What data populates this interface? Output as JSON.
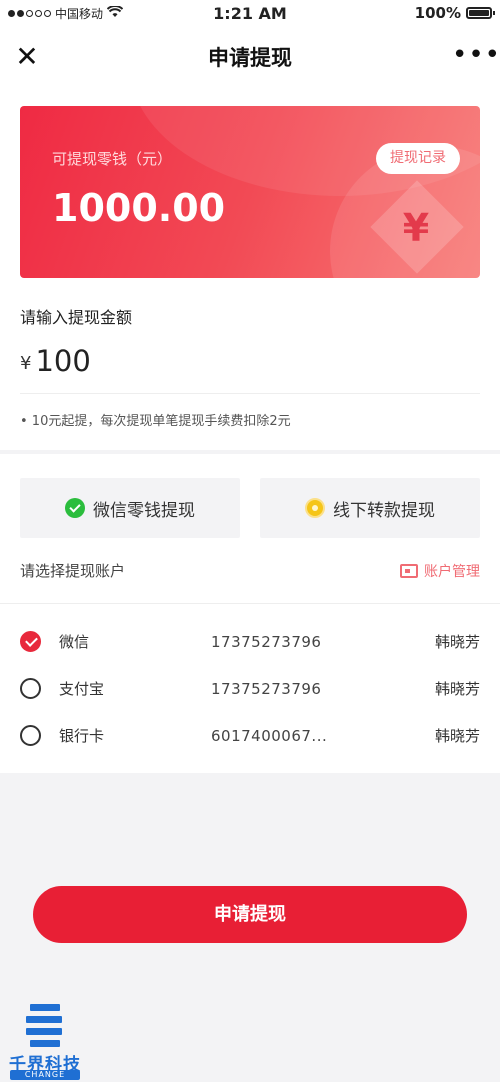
{
  "status_bar": {
    "carrier": "中国移动",
    "time": "1:21 AM",
    "battery": "100%",
    "battery_level": 1.0
  },
  "nav": {
    "title": "申请提现",
    "close_icon": "close-icon",
    "more_icon": "more-icon"
  },
  "balance_card": {
    "label": "可提现零钱（元）",
    "amount": "1000.00",
    "records_button": "提现记录",
    "currency_symbol": "¥"
  },
  "amount_input": {
    "label": "请输入提现金额",
    "currency": "¥",
    "value": "100"
  },
  "fee_note": "• 10元起提，每次提现单笔提现手续费扣除2元",
  "methods": [
    {
      "label": "微信零钱提现",
      "icon": "wechat-icon"
    },
    {
      "label": "线下转款提现",
      "icon": "coin-icon"
    }
  ],
  "account_section": {
    "title": "请选择提现账户",
    "manage_label": "账户管理",
    "accounts": [
      {
        "name": "微信",
        "number": "17375273796",
        "holder": "韩晓芳",
        "checked": true
      },
      {
        "name": "支付宝",
        "number": "17375273796",
        "holder": "韩晓芳",
        "checked": false
      },
      {
        "name": "银行卡",
        "number": "6017400067...",
        "holder": "韩晓芳",
        "checked": false
      }
    ]
  },
  "submit_button": "申请提现",
  "watermark": {
    "text": "千界科技",
    "subtext": "CHANGE"
  },
  "colors": {
    "accent": "#e81f35",
    "card_gradient_start": "#ef2a43",
    "card_gradient_end": "#f87a76",
    "watermark_blue": "#1f6fd3"
  }
}
